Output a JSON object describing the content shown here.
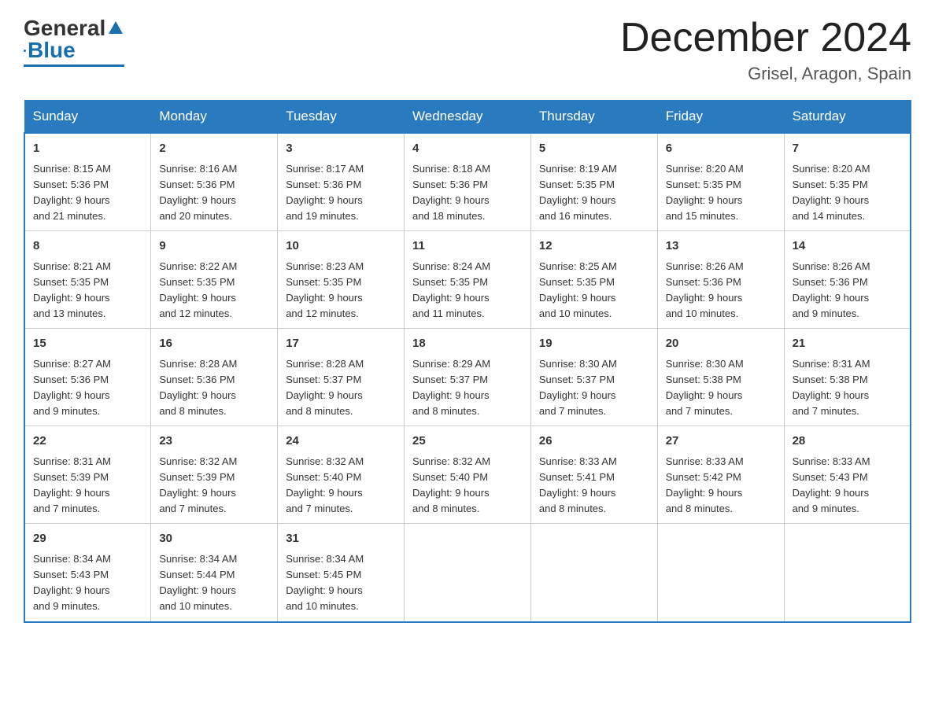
{
  "logo": {
    "general": "General",
    "blue": "Blue"
  },
  "title": "December 2024",
  "location": "Grisel, Aragon, Spain",
  "days_of_week": [
    "Sunday",
    "Monday",
    "Tuesday",
    "Wednesday",
    "Thursday",
    "Friday",
    "Saturday"
  ],
  "weeks": [
    [
      {
        "day": "1",
        "sunrise": "8:15 AM",
        "sunset": "5:36 PM",
        "daylight": "9 hours and 21 minutes."
      },
      {
        "day": "2",
        "sunrise": "8:16 AM",
        "sunset": "5:36 PM",
        "daylight": "9 hours and 20 minutes."
      },
      {
        "day": "3",
        "sunrise": "8:17 AM",
        "sunset": "5:36 PM",
        "daylight": "9 hours and 19 minutes."
      },
      {
        "day": "4",
        "sunrise": "8:18 AM",
        "sunset": "5:36 PM",
        "daylight": "9 hours and 18 minutes."
      },
      {
        "day": "5",
        "sunrise": "8:19 AM",
        "sunset": "5:35 PM",
        "daylight": "9 hours and 16 minutes."
      },
      {
        "day": "6",
        "sunrise": "8:20 AM",
        "sunset": "5:35 PM",
        "daylight": "9 hours and 15 minutes."
      },
      {
        "day": "7",
        "sunrise": "8:20 AM",
        "sunset": "5:35 PM",
        "daylight": "9 hours and 14 minutes."
      }
    ],
    [
      {
        "day": "8",
        "sunrise": "8:21 AM",
        "sunset": "5:35 PM",
        "daylight": "9 hours and 13 minutes."
      },
      {
        "day": "9",
        "sunrise": "8:22 AM",
        "sunset": "5:35 PM",
        "daylight": "9 hours and 12 minutes."
      },
      {
        "day": "10",
        "sunrise": "8:23 AM",
        "sunset": "5:35 PM",
        "daylight": "9 hours and 12 minutes."
      },
      {
        "day": "11",
        "sunrise": "8:24 AM",
        "sunset": "5:35 PM",
        "daylight": "9 hours and 11 minutes."
      },
      {
        "day": "12",
        "sunrise": "8:25 AM",
        "sunset": "5:35 PM",
        "daylight": "9 hours and 10 minutes."
      },
      {
        "day": "13",
        "sunrise": "8:26 AM",
        "sunset": "5:36 PM",
        "daylight": "9 hours and 10 minutes."
      },
      {
        "day": "14",
        "sunrise": "8:26 AM",
        "sunset": "5:36 PM",
        "daylight": "9 hours and 9 minutes."
      }
    ],
    [
      {
        "day": "15",
        "sunrise": "8:27 AM",
        "sunset": "5:36 PM",
        "daylight": "9 hours and 9 minutes."
      },
      {
        "day": "16",
        "sunrise": "8:28 AM",
        "sunset": "5:36 PM",
        "daylight": "9 hours and 8 minutes."
      },
      {
        "day": "17",
        "sunrise": "8:28 AM",
        "sunset": "5:37 PM",
        "daylight": "9 hours and 8 minutes."
      },
      {
        "day": "18",
        "sunrise": "8:29 AM",
        "sunset": "5:37 PM",
        "daylight": "9 hours and 8 minutes."
      },
      {
        "day": "19",
        "sunrise": "8:30 AM",
        "sunset": "5:37 PM",
        "daylight": "9 hours and 7 minutes."
      },
      {
        "day": "20",
        "sunrise": "8:30 AM",
        "sunset": "5:38 PM",
        "daylight": "9 hours and 7 minutes."
      },
      {
        "day": "21",
        "sunrise": "8:31 AM",
        "sunset": "5:38 PM",
        "daylight": "9 hours and 7 minutes."
      }
    ],
    [
      {
        "day": "22",
        "sunrise": "8:31 AM",
        "sunset": "5:39 PM",
        "daylight": "9 hours and 7 minutes."
      },
      {
        "day": "23",
        "sunrise": "8:32 AM",
        "sunset": "5:39 PM",
        "daylight": "9 hours and 7 minutes."
      },
      {
        "day": "24",
        "sunrise": "8:32 AM",
        "sunset": "5:40 PM",
        "daylight": "9 hours and 7 minutes."
      },
      {
        "day": "25",
        "sunrise": "8:32 AM",
        "sunset": "5:40 PM",
        "daylight": "9 hours and 8 minutes."
      },
      {
        "day": "26",
        "sunrise": "8:33 AM",
        "sunset": "5:41 PM",
        "daylight": "9 hours and 8 minutes."
      },
      {
        "day": "27",
        "sunrise": "8:33 AM",
        "sunset": "5:42 PM",
        "daylight": "9 hours and 8 minutes."
      },
      {
        "day": "28",
        "sunrise": "8:33 AM",
        "sunset": "5:43 PM",
        "daylight": "9 hours and 9 minutes."
      }
    ],
    [
      {
        "day": "29",
        "sunrise": "8:34 AM",
        "sunset": "5:43 PM",
        "daylight": "9 hours and 9 minutes."
      },
      {
        "day": "30",
        "sunrise": "8:34 AM",
        "sunset": "5:44 PM",
        "daylight": "9 hours and 10 minutes."
      },
      {
        "day": "31",
        "sunrise": "8:34 AM",
        "sunset": "5:45 PM",
        "daylight": "9 hours and 10 minutes."
      },
      null,
      null,
      null,
      null
    ]
  ],
  "labels": {
    "sunrise": "Sunrise:",
    "sunset": "Sunset:",
    "daylight": "Daylight:"
  }
}
